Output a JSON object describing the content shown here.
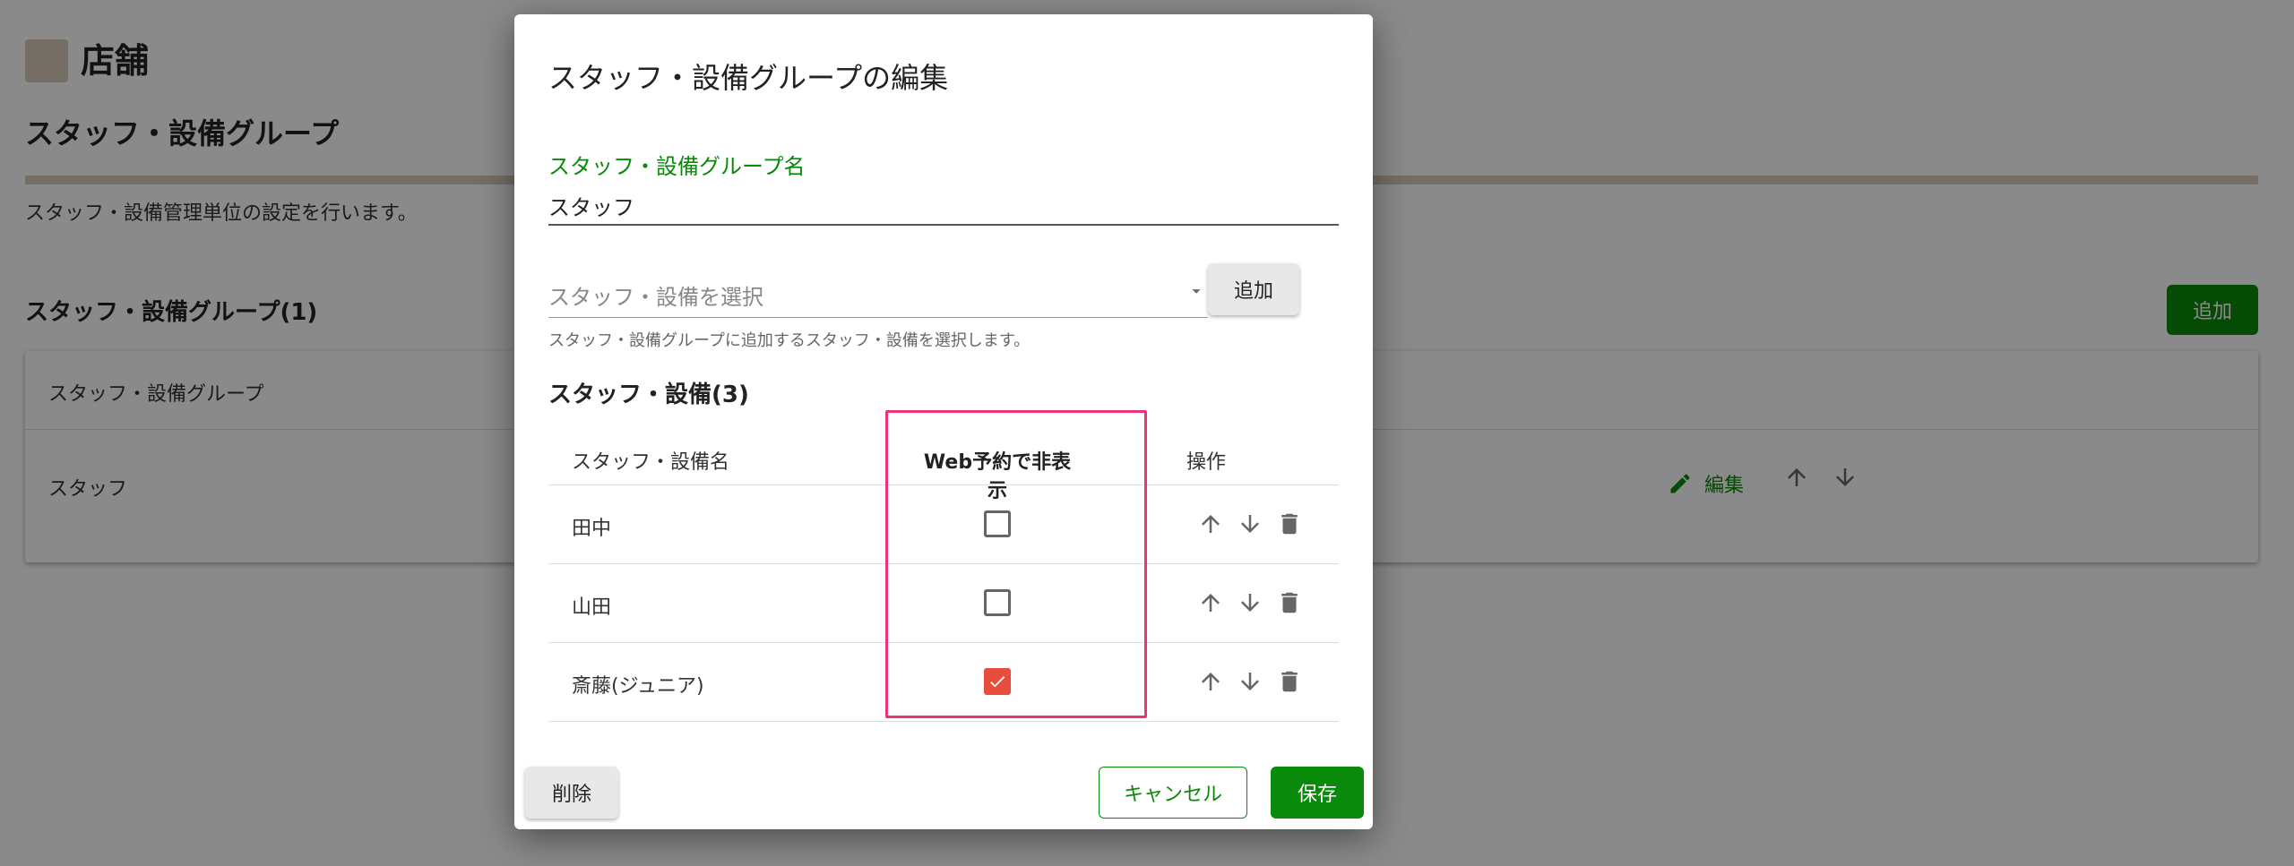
{
  "background": {
    "shop_name": "店舗",
    "page_title": "スタッフ・設備グループ",
    "description": "スタッフ・設備管理単位の設定を行います。",
    "section_title": "スタッフ・設備グループ(1)",
    "add_label": "追加",
    "table": {
      "header": "スタッフ・設備グループ",
      "rows": [
        {
          "name": "スタッフ",
          "edit_label": "編集"
        }
      ]
    }
  },
  "dialog": {
    "title": "スタッフ・設備グループの編集",
    "group_name_label": "スタッフ・設備グループ名",
    "group_name_value": "スタッフ",
    "select_placeholder": "スタッフ・設備を選択",
    "select_helper": "スタッフ・設備グループに追加するスタッフ・設備を選択します。",
    "add_label": "追加",
    "members_title": "スタッフ・設備(3)",
    "columns": {
      "name": "スタッフ・設備名",
      "hidden": "Web予約で非表示",
      "actions": "操作"
    },
    "members": [
      {
        "name": "田中",
        "hidden": false
      },
      {
        "name": "山田",
        "hidden": false
      },
      {
        "name": "斎藤(ジュニア)",
        "hidden": true
      }
    ],
    "delete_label": "削除",
    "cancel_label": "キャンセル",
    "save_label": "保存"
  },
  "colors": {
    "primary": "#0a8a0a",
    "checked": "#e74c3c",
    "highlight": "#e8357a",
    "accent_bar": "#d8cbbb"
  },
  "icons": {
    "up": "arrow-up-icon",
    "down": "arrow-down-icon",
    "delete": "trash-icon",
    "edit": "pencil-icon",
    "caret": "caret-down-icon",
    "check": "check-icon"
  }
}
